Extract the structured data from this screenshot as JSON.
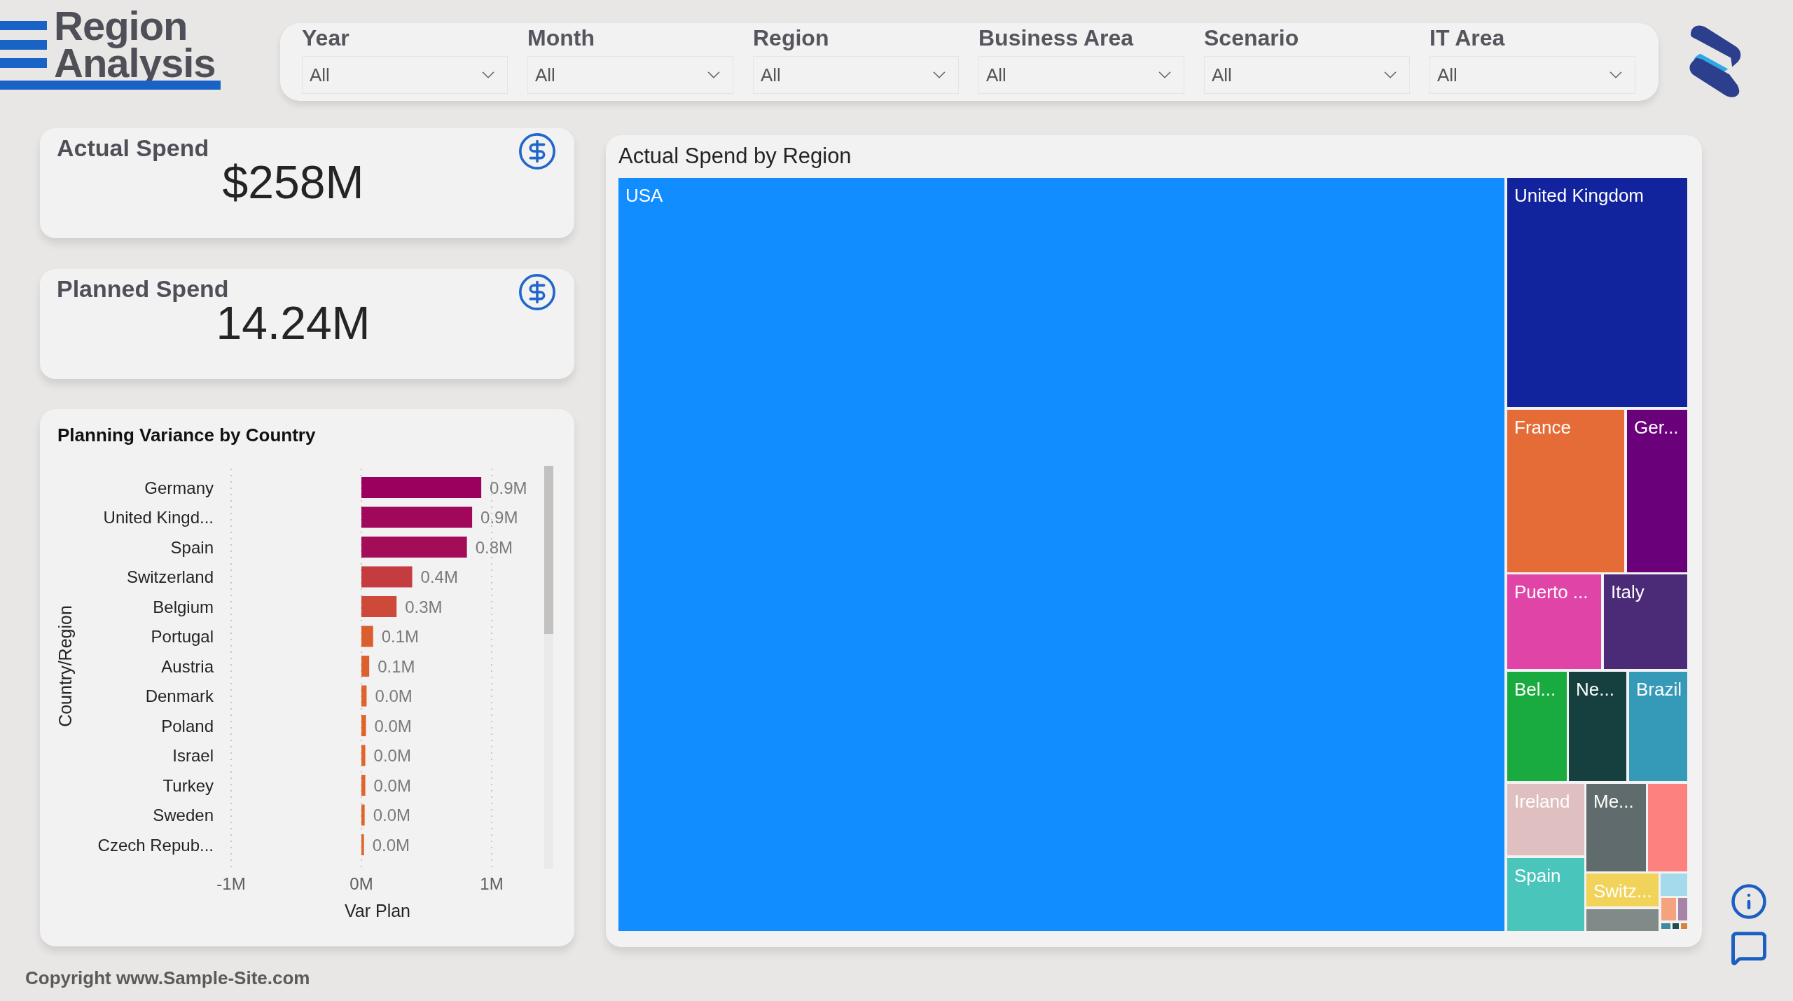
{
  "header": {
    "title": "Region Analysis"
  },
  "filters": [
    {
      "label": "Year",
      "value": "All"
    },
    {
      "label": "Month",
      "value": "All"
    },
    {
      "label": "Region",
      "value": "All"
    },
    {
      "label": "Business Area",
      "value": "All"
    },
    {
      "label": "Scenario",
      "value": "All"
    },
    {
      "label": "IT Area",
      "value": "All"
    }
  ],
  "kpis": [
    {
      "title": "Actual Spend",
      "value": "$258M"
    },
    {
      "title": "Planned Spend",
      "value": "14.24M"
    }
  ],
  "variance_chart": {
    "chart_data": {
      "type": "bar",
      "orientation": "horizontal",
      "title": "Planning Variance by Country",
      "xlabel": "Var Plan",
      "ylabel": "Country/Region",
      "categories": [
        "Germany",
        "United Kingd...",
        "Spain",
        "Switzerland",
        "Belgium",
        "Portugal",
        "Austria",
        "Denmark",
        "Poland",
        "Israel",
        "Turkey",
        "Sweden",
        "Czech Repub..."
      ],
      "values": [
        0.92,
        0.85,
        0.81,
        0.39,
        0.27,
        0.09,
        0.06,
        0.04,
        0.035,
        0.03,
        0.03,
        0.025,
        0.02
      ],
      "xlim": [
        -1,
        1
      ],
      "xticks": [
        {
          "value": -1,
          "label": "-1M"
        },
        {
          "value": 0,
          "label": "0M"
        },
        {
          "value": 1,
          "label": "1M"
        }
      ],
      "grid": true,
      "value_labels": [
        "0.9M",
        "0.9M",
        "0.8M",
        "0.4M",
        "0.3M",
        "0.1M",
        "0.1M",
        "0.0M",
        "0.0M",
        "0.0M",
        "0.0M",
        "0.0M",
        "0.0M"
      ]
    }
  },
  "treemap": {
    "title": "Actual Spend by Region",
    "tiles": [
      {
        "label": "USA",
        "color": "#118dff"
      },
      {
        "label": "United Kingdom",
        "color": "#12239e"
      },
      {
        "label": "France",
        "color": "#e66c37"
      },
      {
        "label": "Ger...",
        "color": "#6b007b"
      },
      {
        "label": "Puerto ...",
        "color": "#e044a7"
      },
      {
        "label": "Italy",
        "color": "#4b2a78"
      },
      {
        "label": "Bel...",
        "color": "#1aab40"
      },
      {
        "label": "Ne...",
        "color": "#15403f"
      },
      {
        "label": "Brazil",
        "color": "#3599b8"
      },
      {
        "label": "Ireland",
        "color": "#dfbfbf"
      },
      {
        "label": "Spain",
        "color": "#4ac5bb"
      },
      {
        "label": "Me...",
        "color": "#5f6b6d"
      },
      {
        "color": "#fd817e"
      },
      {
        "label": "Switz...",
        "color": "#f2d35a"
      },
      {
        "color": "#7f8a89"
      },
      {
        "color": "#a4daec"
      },
      {
        "color": "#f5a27f"
      },
      {
        "color": "#a883a8"
      },
      {
        "color": "#3f8a9c"
      },
      {
        "color": "#1f4d4d"
      },
      {
        "color": "#d9823b"
      }
    ]
  },
  "footer": {
    "copyright": "Copyright www.Sample-Site.com"
  }
}
